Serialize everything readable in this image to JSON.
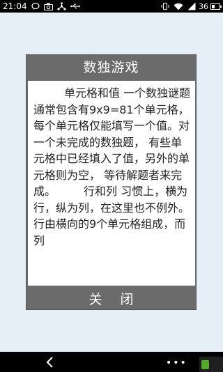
{
  "status_bar": {
    "time": "21:04",
    "battery_text": "36",
    "battery_level": 0.36,
    "icons": [
      "chat-icon",
      "camera-icon",
      "share-icon",
      "usb-icon",
      "vibrate-icon",
      "wifi-icon",
      "signal-icon",
      "battery-icon"
    ]
  },
  "dialog": {
    "title": "数独游戏",
    "body": "单元格和值 一个数独谜题通常包含有9x9=81个单元格， 每个单元格仅能填写一个值。对一个未完成的数独题， 有些单元格中已经填入了值，另外的单元格则为空， 等待解题者来完成。　　　行和列 习惯上，横为行，纵为列，在这里也不例外。 行由横向的9个单元格组成，而列",
    "close_label": "关闭"
  },
  "nav_bar": {
    "back_icon": "chevron-left-icon",
    "more_icon": "more-dots-icon",
    "more_text": "•••"
  },
  "colors": {
    "background": "#e6eef8",
    "dialog_frame": "#6b6b6b",
    "status_bar": "#000000"
  }
}
